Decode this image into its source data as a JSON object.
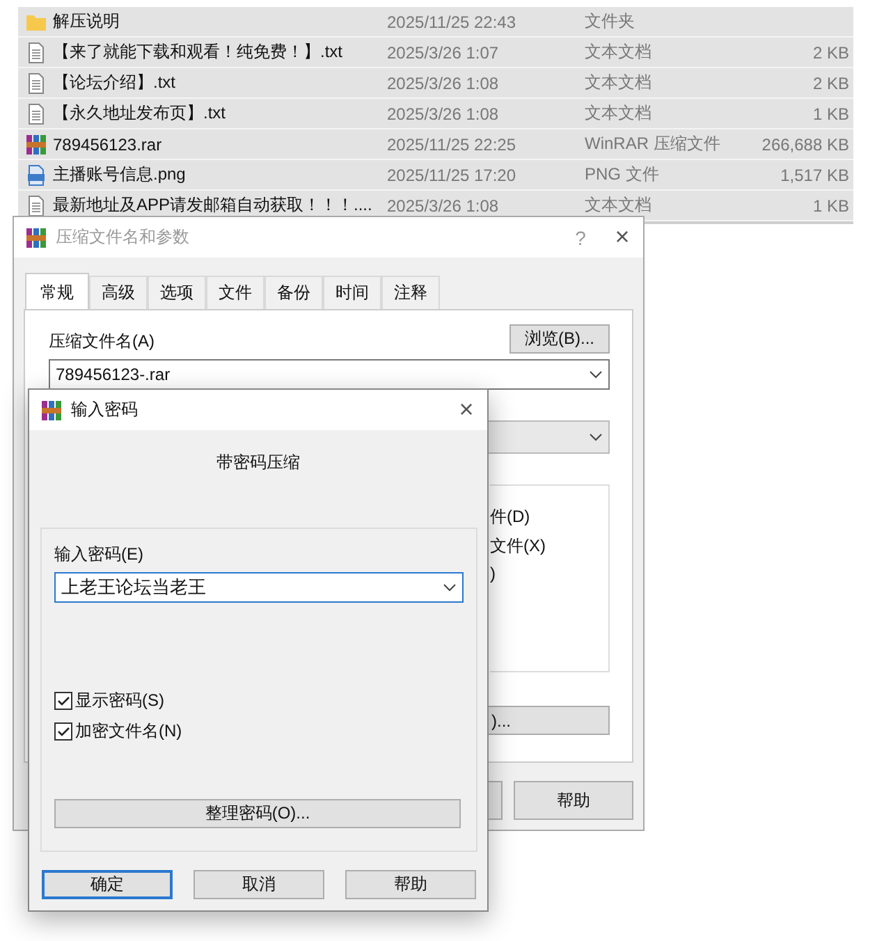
{
  "files": [
    {
      "kind": "folder",
      "name": "解压说明",
      "date": "2025/11/25 22:43",
      "type": "文件夹"
    },
    {
      "kind": "text",
      "name": "【来了就能下载和观看！纯免费！】.txt",
      "date": "2025/3/26 1:07",
      "type": "文本文档",
      "size": "2 KB"
    },
    {
      "kind": "text",
      "name": "【论坛介绍】.txt",
      "date": "2025/3/26 1:08",
      "type": "文本文档",
      "size": "2 KB"
    },
    {
      "kind": "text",
      "name": "【永久地址发布页】.txt",
      "date": "2025/3/26 1:08",
      "type": "文本文档",
      "size": "1 KB"
    },
    {
      "kind": "rar",
      "name": "789456123.rar",
      "date": "2025/11/25 22:25",
      "type": "WinRAR 压缩文件",
      "size": "266,688 KB"
    },
    {
      "kind": "png",
      "name": "主播账号信息.png",
      "date": "2025/11/25 17:20",
      "type": "PNG 文件",
      "size": "1,517 KB"
    },
    {
      "kind": "text",
      "name": "最新地址及APP请发邮箱自动获取！！！....",
      "date": "2025/3/26 1:08",
      "type": "文本文档",
      "size": "1 KB"
    }
  ],
  "archive_dialog": {
    "title": "压缩文件名和参数",
    "help_glyph": "?",
    "close_glyph": "×",
    "tabs": [
      {
        "label": "常规",
        "selected": true
      },
      {
        "label": "高级",
        "selected": false
      },
      {
        "label": "选项",
        "selected": false
      },
      {
        "label": "文件",
        "selected": false
      },
      {
        "label": "备份",
        "selected": false
      },
      {
        "label": "时间",
        "selected": false
      },
      {
        "label": "注释",
        "selected": false
      }
    ],
    "filename_label": "压缩文件名(A)",
    "browse_button": "浏览(B)...",
    "filename_value": "789456123-.rar",
    "options_visible": [
      "件(D)",
      "文件(X)",
      ")"
    ],
    "partial_button": ")...",
    "help_button": "帮助"
  },
  "password_dialog": {
    "title": "输入密码",
    "close_glyph": "×",
    "heading": "带密码压缩",
    "password_label": "输入密码(E)",
    "password_value": "上老王论坛当老王",
    "checkboxes": [
      {
        "label": "显示密码(S)",
        "checked": true
      },
      {
        "label": "加密文件名(N)",
        "checked": true
      }
    ],
    "organize_button": "整理密码(O)...",
    "buttons": [
      {
        "label": "确定",
        "default": true
      },
      {
        "label": "取消",
        "default": false
      },
      {
        "label": "帮助",
        "default": false
      }
    ]
  }
}
